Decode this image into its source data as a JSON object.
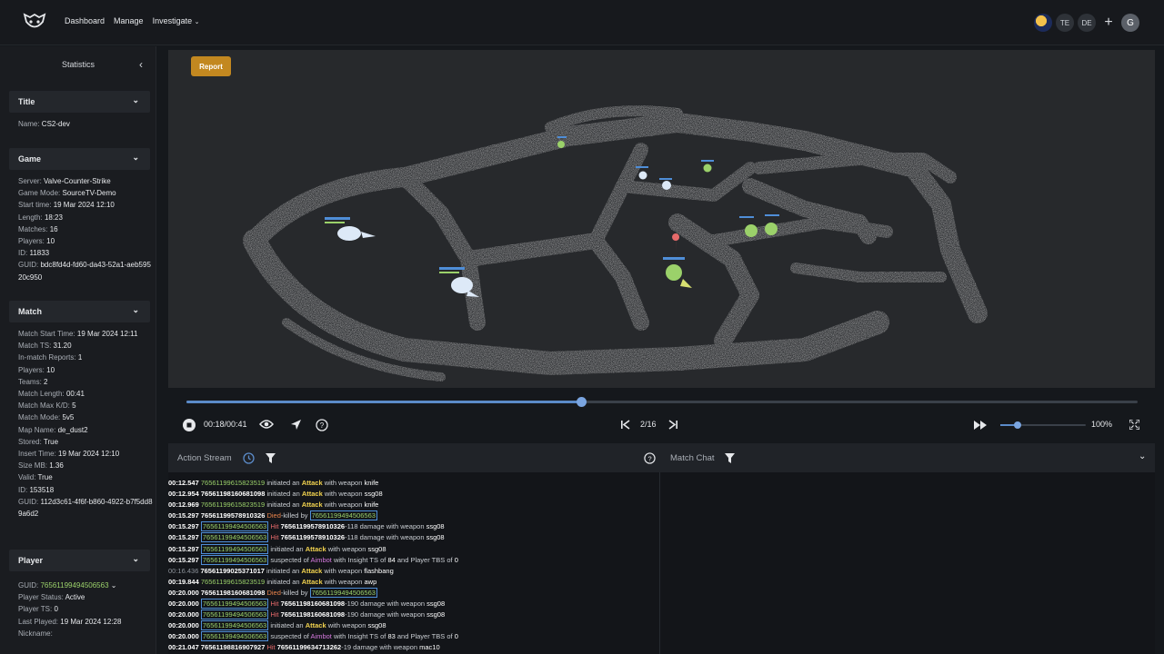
{
  "nav": {
    "items": [
      {
        "label": "Dashboard"
      },
      {
        "label": "Manage"
      },
      {
        "label": "Investigate"
      }
    ],
    "avatars": [
      "TE",
      "DE"
    ],
    "user_initial": "G"
  },
  "sidebar": {
    "title": "Statistics",
    "sections": {
      "title": {
        "header": "Title",
        "rows": [
          {
            "k": "Name:",
            "v": "CS2-dev"
          }
        ]
      },
      "game": {
        "header": "Game",
        "rows": [
          {
            "k": "Server:",
            "v": "Valve-Counter-Strike"
          },
          {
            "k": "Game Mode:",
            "v": "SourceTV-Demo"
          },
          {
            "k": "Start time:",
            "v": "19 Mar 2024 12:10"
          },
          {
            "k": "Length:",
            "v": "18:23"
          },
          {
            "k": "Matches:",
            "v": "16"
          },
          {
            "k": "Players:",
            "v": "10"
          },
          {
            "k": "ID:",
            "v": "11833"
          },
          {
            "k": "GUID:",
            "v": "bdc8fd4d-fd60-da43-52a1-aeb59520c950"
          }
        ]
      },
      "match": {
        "header": "Match",
        "rows": [
          {
            "k": "Match Start Time:",
            "v": "19 Mar 2024 12:11"
          },
          {
            "k": "Match TS:",
            "v": "31.20"
          },
          {
            "k": "In-match Reports:",
            "v": "1"
          },
          {
            "k": "Players:",
            "v": "10"
          },
          {
            "k": "Teams:",
            "v": "2"
          },
          {
            "k": "Match Length:",
            "v": "00:41"
          },
          {
            "k": "Match Max K/D:",
            "v": "5"
          },
          {
            "k": "Match Mode:",
            "v": "5v5"
          },
          {
            "k": "Map Name:",
            "v": "de_dust2"
          },
          {
            "k": "Stored:",
            "v": "True"
          },
          {
            "k": "Insert Time:",
            "v": "19 Mar 2024 12:10"
          },
          {
            "k": "Size MB:",
            "v": "1.36"
          },
          {
            "k": "Valid:",
            "v": "True"
          },
          {
            "k": "ID:",
            "v": "153518"
          },
          {
            "k": "GUID:",
            "v": "112d3c61-4f6f-b860-4922-b7f5dd89a6d2"
          }
        ]
      },
      "player": {
        "header": "Player",
        "guid_label": "GUID:",
        "guid_value": "76561199494506563",
        "rows": [
          {
            "k": "Player Status:",
            "v": "Active"
          },
          {
            "k": "Player TS:",
            "v": "0"
          },
          {
            "k": "Last Played:",
            "v": "19 Mar 2024 12:28"
          },
          {
            "k": "Nickname:",
            "v": ""
          }
        ]
      }
    }
  },
  "viewport": {
    "report_label": "Report"
  },
  "playback": {
    "progress": 0.415,
    "time": "00:18/00:41",
    "round": "2/16",
    "volume": 0.2,
    "zoom": "100%"
  },
  "panels": {
    "action_stream": "Action Stream",
    "match_chat": "Match Chat"
  },
  "log": [
    {
      "t": "00:12.547",
      "dim": false,
      "p": [
        {
          "c": "idg",
          "s": "76561199615823519"
        },
        {
          "c": "",
          "s": " initiated an "
        },
        {
          "c": "atk",
          "s": "Attack"
        },
        {
          "c": "",
          "s": " with weapon "
        },
        {
          "c": "w",
          "s": "knife"
        }
      ]
    },
    {
      "t": "00:12.954",
      "dim": false,
      "p": [
        {
          "c": "id",
          "s": "76561198160681098"
        },
        {
          "c": "",
          "s": " initiated an "
        },
        {
          "c": "atk",
          "s": "Attack"
        },
        {
          "c": "",
          "s": " with weapon "
        },
        {
          "c": "w",
          "s": "ssg08"
        }
      ]
    },
    {
      "t": "00:12.969",
      "dim": false,
      "p": [
        {
          "c": "idg",
          "s": "76561199615823519"
        },
        {
          "c": "",
          "s": " initiated an "
        },
        {
          "c": "atk",
          "s": "Attack"
        },
        {
          "c": "",
          "s": " with weapon "
        },
        {
          "c": "w",
          "s": "knife"
        }
      ]
    },
    {
      "t": "00:15.297",
      "dim": false,
      "p": [
        {
          "c": "id",
          "s": "76561199578910326"
        },
        {
          "c": "died",
          "s": " Died"
        },
        {
          "c": "",
          "s": "-killed by "
        },
        {
          "c": "box",
          "s": "76561199494506563"
        }
      ]
    },
    {
      "t": "00:15.297",
      "dim": false,
      "p": [
        {
          "c": "box",
          "s": "76561199494506563"
        },
        {
          "c": "hit",
          "s": " Hit "
        },
        {
          "c": "id",
          "s": "76561199578910326"
        },
        {
          "c": "",
          "s": "-118 damage with weapon "
        },
        {
          "c": "w",
          "s": "ssg08"
        }
      ]
    },
    {
      "t": "00:15.297",
      "dim": false,
      "p": [
        {
          "c": "box",
          "s": "76561199494506563"
        },
        {
          "c": "hit",
          "s": " Hit "
        },
        {
          "c": "id",
          "s": "76561199578910326"
        },
        {
          "c": "",
          "s": "-118 damage with weapon "
        },
        {
          "c": "w",
          "s": "ssg08"
        }
      ]
    },
    {
      "t": "00:15.297",
      "dim": false,
      "p": [
        {
          "c": "box",
          "s": "76561199494506563"
        },
        {
          "c": "",
          "s": " initiated an "
        },
        {
          "c": "atk",
          "s": "Attack"
        },
        {
          "c": "",
          "s": " with weapon "
        },
        {
          "c": "w",
          "s": "ssg08"
        }
      ]
    },
    {
      "t": "00:15.297",
      "dim": false,
      "p": [
        {
          "c": "box",
          "s": "76561199494506563"
        },
        {
          "c": "",
          "s": " suspected of "
        },
        {
          "c": "aim",
          "s": "Aimbot"
        },
        {
          "c": "",
          "s": " with Insight TS of "
        },
        {
          "c": "w",
          "s": "84"
        },
        {
          "c": "",
          "s": " and Player TBS of "
        },
        {
          "c": "w",
          "s": "0"
        }
      ]
    },
    {
      "t": "00:16.436",
      "dim": true,
      "p": [
        {
          "c": "id",
          "s": "76561199025371017"
        },
        {
          "c": "",
          "s": " initiated an "
        },
        {
          "c": "atk",
          "s": "Attack"
        },
        {
          "c": "",
          "s": " with weapon "
        },
        {
          "c": "w",
          "s": "flashbang"
        }
      ]
    },
    {
      "t": "00:19.844",
      "dim": false,
      "p": [
        {
          "c": "idg",
          "s": "76561199615823519"
        },
        {
          "c": "",
          "s": " initiated an "
        },
        {
          "c": "atk",
          "s": "Attack"
        },
        {
          "c": "",
          "s": " with weapon "
        },
        {
          "c": "w",
          "s": "awp"
        }
      ]
    },
    {
      "t": "00:20.000",
      "dim": false,
      "p": [
        {
          "c": "id",
          "s": "76561198160681098"
        },
        {
          "c": "died",
          "s": " Died"
        },
        {
          "c": "",
          "s": "-killed by "
        },
        {
          "c": "box",
          "s": "76561199494506563"
        }
      ]
    },
    {
      "t": "00:20.000",
      "dim": false,
      "p": [
        {
          "c": "box",
          "s": "76561199494506563"
        },
        {
          "c": "hit",
          "s": " Hit "
        },
        {
          "c": "id",
          "s": "76561198160681098"
        },
        {
          "c": "",
          "s": "-190 damage with weapon "
        },
        {
          "c": "w",
          "s": "ssg08"
        }
      ]
    },
    {
      "t": "00:20.000",
      "dim": false,
      "p": [
        {
          "c": "box",
          "s": "76561199494506563"
        },
        {
          "c": "hit",
          "s": " Hit "
        },
        {
          "c": "id",
          "s": "76561198160681098"
        },
        {
          "c": "",
          "s": "-190 damage with weapon "
        },
        {
          "c": "w",
          "s": "ssg08"
        }
      ]
    },
    {
      "t": "00:20.000",
      "dim": false,
      "p": [
        {
          "c": "box",
          "s": "76561199494506563"
        },
        {
          "c": "",
          "s": " initiated an "
        },
        {
          "c": "atk",
          "s": "Attack"
        },
        {
          "c": "",
          "s": " with weapon "
        },
        {
          "c": "w",
          "s": "ssg08"
        }
      ]
    },
    {
      "t": "00:20.000",
      "dim": false,
      "p": [
        {
          "c": "box",
          "s": "76561199494506563"
        },
        {
          "c": "",
          "s": " suspected of "
        },
        {
          "c": "aim",
          "s": "Aimbot"
        },
        {
          "c": "",
          "s": " with Insight TS of "
        },
        {
          "c": "w",
          "s": "83"
        },
        {
          "c": "",
          "s": " and Player TBS of "
        },
        {
          "c": "w",
          "s": "0"
        }
      ]
    },
    {
      "t": "00:21.047",
      "dim": false,
      "p": [
        {
          "c": "id",
          "s": "76561198816907927"
        },
        {
          "c": "hit",
          "s": " Hit "
        },
        {
          "c": "id",
          "s": "76561199634713262"
        },
        {
          "c": "",
          "s": "-19 damage with weapon "
        },
        {
          "c": "w",
          "s": "mac10"
        }
      ]
    }
  ],
  "colors": {
    "accent": "#5b8bc9",
    "report": "#c38820",
    "player_green": "#9bd16a",
    "team_blue": "#dde9f7"
  }
}
